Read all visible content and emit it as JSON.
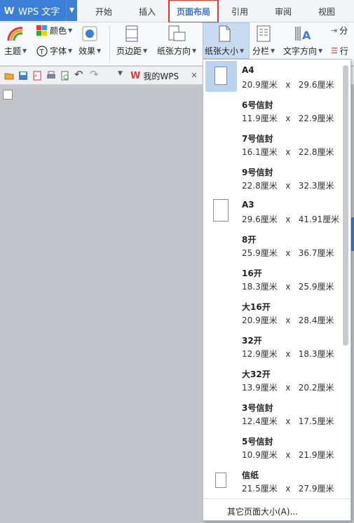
{
  "app": {
    "logo": "W",
    "title": "WPS 文字",
    "accent": "#3c7fd6"
  },
  "tabs": [
    {
      "label": "开始"
    },
    {
      "label": "插入"
    },
    {
      "label": "页面布局",
      "active": true
    },
    {
      "label": "引用"
    },
    {
      "label": "审阅"
    },
    {
      "label": "视图"
    }
  ],
  "ribbon": {
    "theme": "主题",
    "color": "颜色",
    "font": "字体",
    "effect": "效果",
    "margin": "页边距",
    "orientation": "纸张方向",
    "size": "纸张大小",
    "columns": "分栏",
    "text_direction": "文字方向",
    "fen": "分",
    "hang": "行"
  },
  "quickbar": {
    "doc_tab": "我的WPS",
    "doc_tab_icon": "W",
    "close": "×"
  },
  "paper_sizes": [
    {
      "name": "A4",
      "w": "20.9厘米",
      "h": "29.6厘米",
      "selected": true
    },
    {
      "name": "6号信封",
      "w": "11.9厘米",
      "h": "22.9厘米"
    },
    {
      "name": "7号信封",
      "w": "16.1厘米",
      "h": "22.8厘米"
    },
    {
      "name": "9号信封",
      "w": "22.8厘米",
      "h": "32.3厘米"
    },
    {
      "name": "A3",
      "w": "29.6厘米",
      "h": "41.91厘米"
    },
    {
      "name": "8开",
      "w": "25.9厘米",
      "h": "36.7厘米"
    },
    {
      "name": "16开",
      "w": "18.3厘米",
      "h": "25.9厘米"
    },
    {
      "name": "大16开",
      "w": "20.9厘米",
      "h": "28.4厘米"
    },
    {
      "name": "32开",
      "w": "12.9厘米",
      "h": "18.3厘米"
    },
    {
      "name": "大32开",
      "w": "13.9厘米",
      "h": "20.2厘米"
    },
    {
      "name": "3号信封",
      "w": "12.4厘米",
      "h": "17.5厘米"
    },
    {
      "name": "5号信封",
      "w": "10.9厘米",
      "h": "21.9厘米"
    },
    {
      "name": "信纸",
      "w": "21.5厘米",
      "h": "27.9厘米"
    }
  ],
  "times": "x",
  "more_sizes": "其它页面大小(A)..."
}
